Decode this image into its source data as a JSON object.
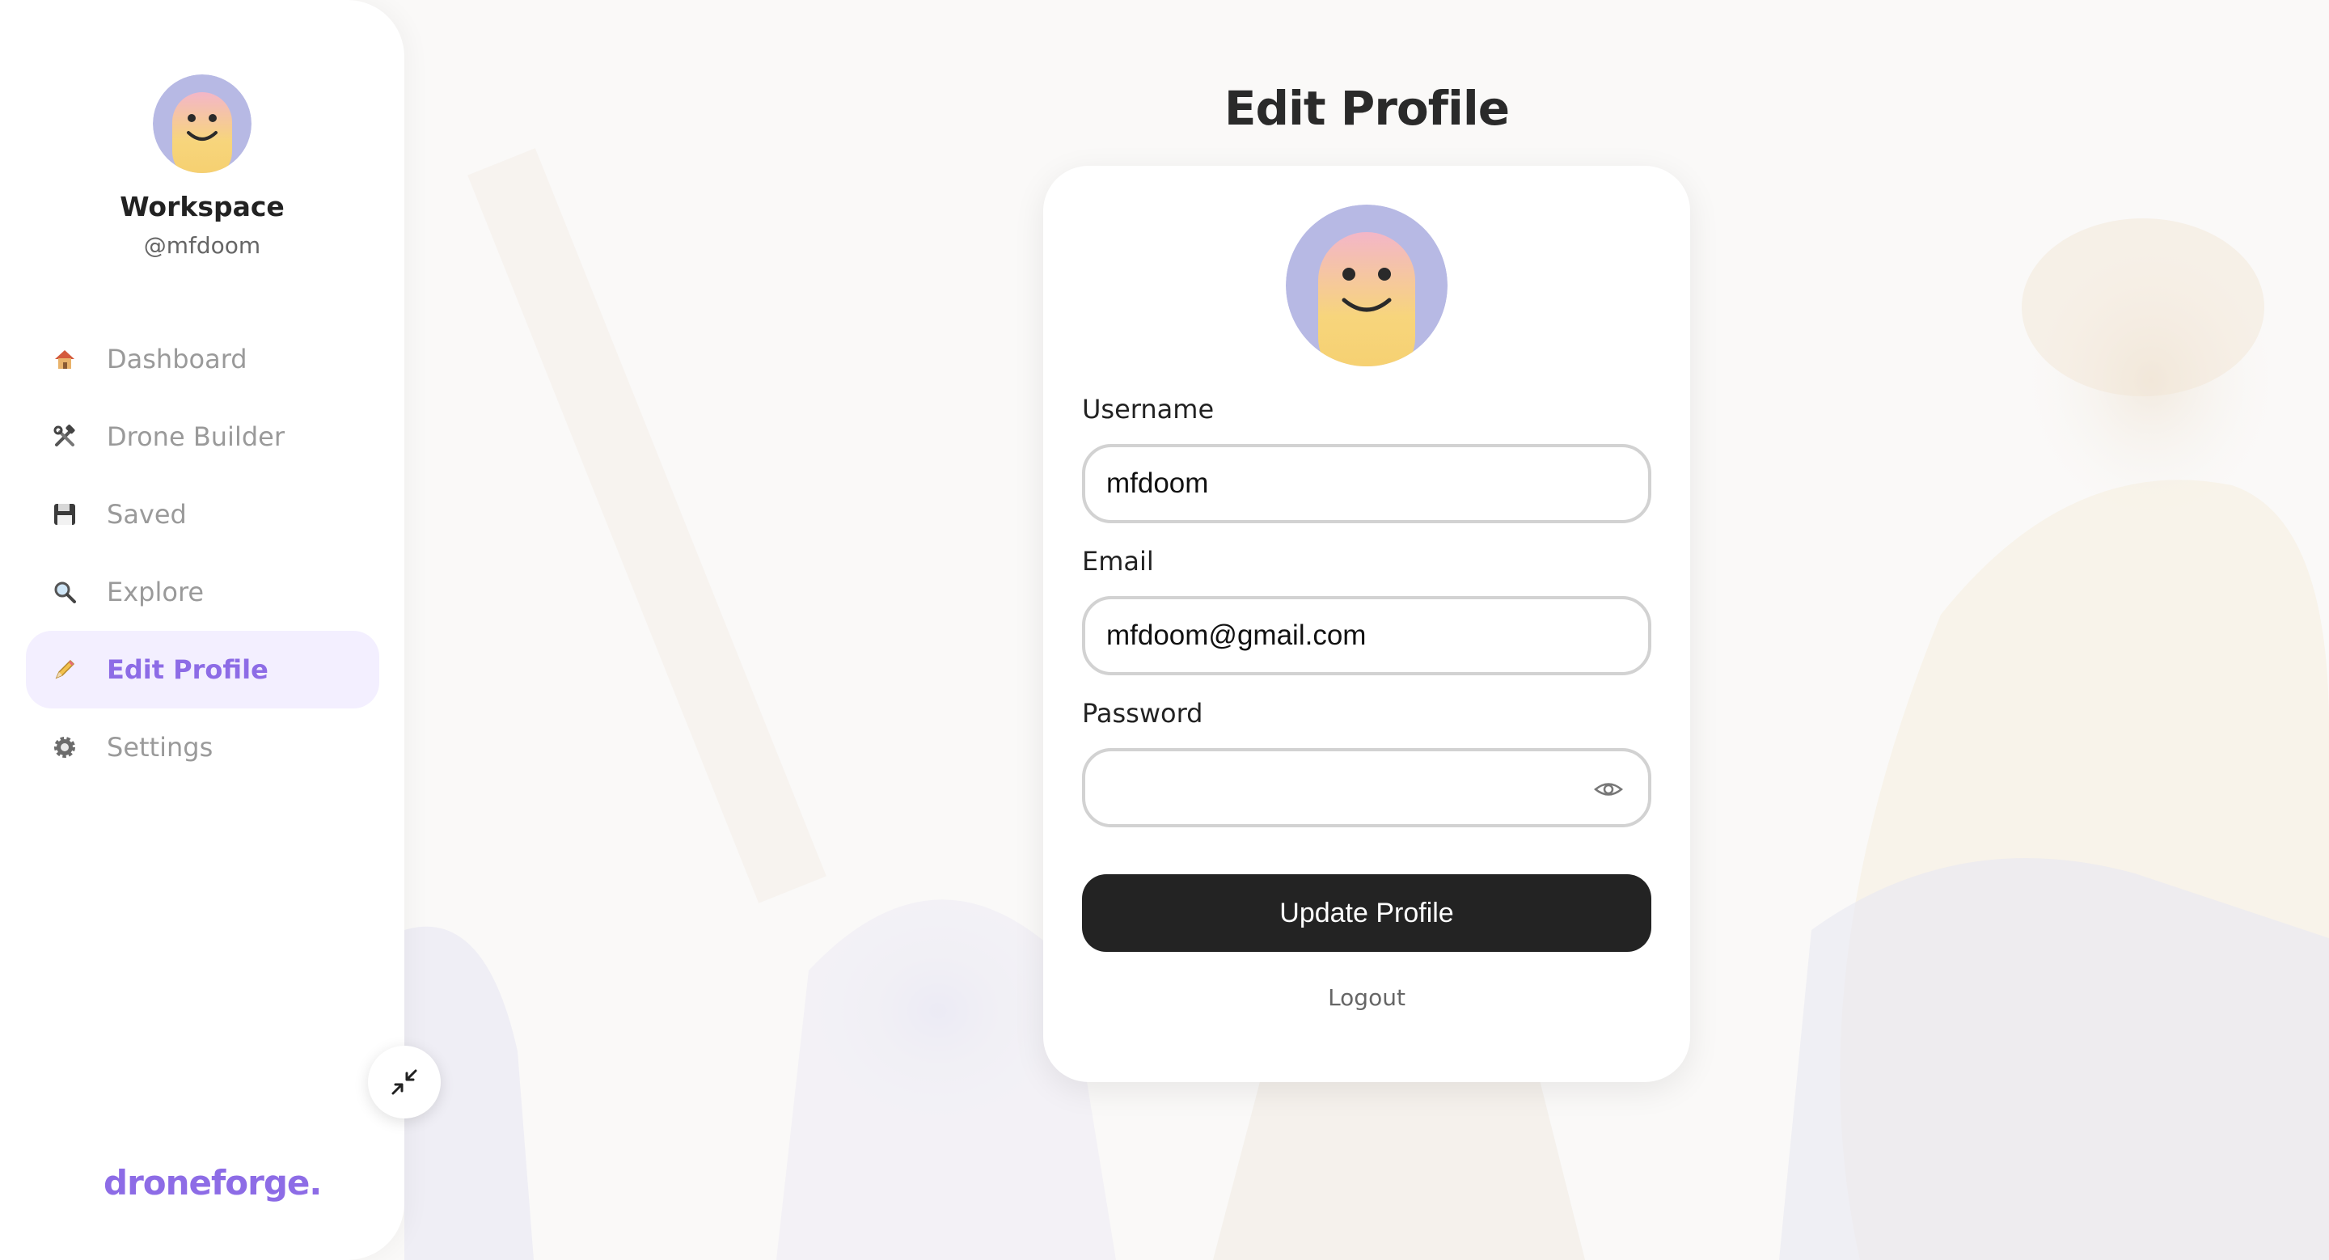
{
  "sidebar": {
    "workspace_name": "Workspace",
    "handle": "@mfdoom",
    "items": [
      {
        "label": "Dashboard",
        "icon": "house-icon",
        "active": false
      },
      {
        "label": "Drone Builder",
        "icon": "tools-icon",
        "active": false
      },
      {
        "label": "Saved",
        "icon": "floppy-disk-icon",
        "active": false
      },
      {
        "label": "Explore",
        "icon": "magnifier-icon",
        "active": false
      },
      {
        "label": "Edit Profile",
        "icon": "pencil-icon",
        "active": true
      },
      {
        "label": "Settings",
        "icon": "gear-icon",
        "active": false
      }
    ],
    "collapse_icon": "collapse-arrows-icon",
    "brand": "droneforge."
  },
  "main": {
    "title": "Edit Profile",
    "form": {
      "username_label": "Username",
      "username_value": "mfdoom",
      "email_label": "Email",
      "email_value": "mfdoom@gmail.com",
      "password_label": "Password",
      "password_value": "",
      "password_toggle_icon": "eye-icon",
      "submit_label": "Update Profile",
      "logout_label": "Logout"
    }
  },
  "colors": {
    "accent": "#8d6ce6",
    "active_bg": "#f3efff",
    "button_bg": "#232323",
    "avatar_bg": "#b7b9e4",
    "avatar_face": "#f6d27a"
  }
}
